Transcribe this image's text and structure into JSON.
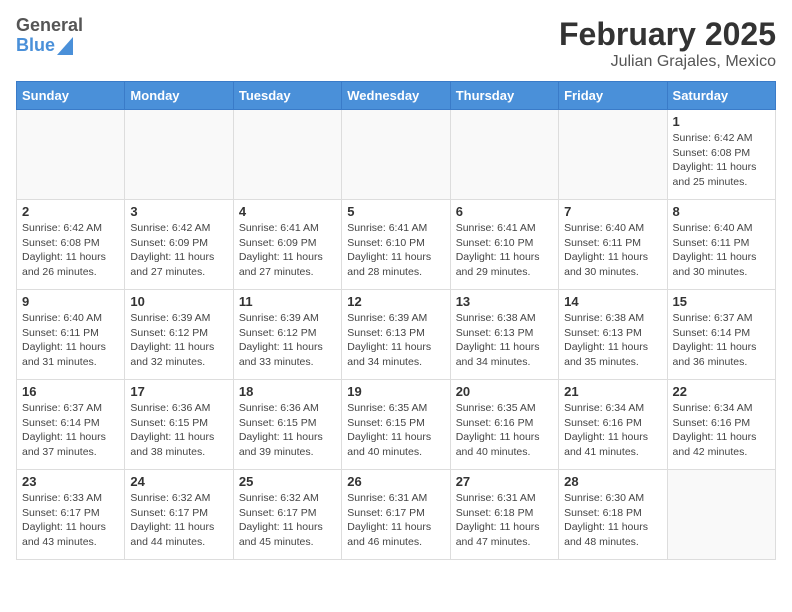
{
  "logo": {
    "text_general": "General",
    "text_blue": "Blue"
  },
  "header": {
    "month_year": "February 2025",
    "location": "Julian Grajales, Mexico"
  },
  "weekdays": [
    "Sunday",
    "Monday",
    "Tuesday",
    "Wednesday",
    "Thursday",
    "Friday",
    "Saturday"
  ],
  "weeks": [
    [
      {
        "day": "",
        "info": ""
      },
      {
        "day": "",
        "info": ""
      },
      {
        "day": "",
        "info": ""
      },
      {
        "day": "",
        "info": ""
      },
      {
        "day": "",
        "info": ""
      },
      {
        "day": "",
        "info": ""
      },
      {
        "day": "1",
        "info": "Sunrise: 6:42 AM\nSunset: 6:08 PM\nDaylight: 11 hours and 25 minutes."
      }
    ],
    [
      {
        "day": "2",
        "info": "Sunrise: 6:42 AM\nSunset: 6:08 PM\nDaylight: 11 hours and 26 minutes."
      },
      {
        "day": "3",
        "info": "Sunrise: 6:42 AM\nSunset: 6:09 PM\nDaylight: 11 hours and 27 minutes."
      },
      {
        "day": "4",
        "info": "Sunrise: 6:41 AM\nSunset: 6:09 PM\nDaylight: 11 hours and 27 minutes."
      },
      {
        "day": "5",
        "info": "Sunrise: 6:41 AM\nSunset: 6:10 PM\nDaylight: 11 hours and 28 minutes."
      },
      {
        "day": "6",
        "info": "Sunrise: 6:41 AM\nSunset: 6:10 PM\nDaylight: 11 hours and 29 minutes."
      },
      {
        "day": "7",
        "info": "Sunrise: 6:40 AM\nSunset: 6:11 PM\nDaylight: 11 hours and 30 minutes."
      },
      {
        "day": "8",
        "info": "Sunrise: 6:40 AM\nSunset: 6:11 PM\nDaylight: 11 hours and 30 minutes."
      }
    ],
    [
      {
        "day": "9",
        "info": "Sunrise: 6:40 AM\nSunset: 6:11 PM\nDaylight: 11 hours and 31 minutes."
      },
      {
        "day": "10",
        "info": "Sunrise: 6:39 AM\nSunset: 6:12 PM\nDaylight: 11 hours and 32 minutes."
      },
      {
        "day": "11",
        "info": "Sunrise: 6:39 AM\nSunset: 6:12 PM\nDaylight: 11 hours and 33 minutes."
      },
      {
        "day": "12",
        "info": "Sunrise: 6:39 AM\nSunset: 6:13 PM\nDaylight: 11 hours and 34 minutes."
      },
      {
        "day": "13",
        "info": "Sunrise: 6:38 AM\nSunset: 6:13 PM\nDaylight: 11 hours and 34 minutes."
      },
      {
        "day": "14",
        "info": "Sunrise: 6:38 AM\nSunset: 6:13 PM\nDaylight: 11 hours and 35 minutes."
      },
      {
        "day": "15",
        "info": "Sunrise: 6:37 AM\nSunset: 6:14 PM\nDaylight: 11 hours and 36 minutes."
      }
    ],
    [
      {
        "day": "16",
        "info": "Sunrise: 6:37 AM\nSunset: 6:14 PM\nDaylight: 11 hours and 37 minutes."
      },
      {
        "day": "17",
        "info": "Sunrise: 6:36 AM\nSunset: 6:15 PM\nDaylight: 11 hours and 38 minutes."
      },
      {
        "day": "18",
        "info": "Sunrise: 6:36 AM\nSunset: 6:15 PM\nDaylight: 11 hours and 39 minutes."
      },
      {
        "day": "19",
        "info": "Sunrise: 6:35 AM\nSunset: 6:15 PM\nDaylight: 11 hours and 40 minutes."
      },
      {
        "day": "20",
        "info": "Sunrise: 6:35 AM\nSunset: 6:16 PM\nDaylight: 11 hours and 40 minutes."
      },
      {
        "day": "21",
        "info": "Sunrise: 6:34 AM\nSunset: 6:16 PM\nDaylight: 11 hours and 41 minutes."
      },
      {
        "day": "22",
        "info": "Sunrise: 6:34 AM\nSunset: 6:16 PM\nDaylight: 11 hours and 42 minutes."
      }
    ],
    [
      {
        "day": "23",
        "info": "Sunrise: 6:33 AM\nSunset: 6:17 PM\nDaylight: 11 hours and 43 minutes."
      },
      {
        "day": "24",
        "info": "Sunrise: 6:32 AM\nSunset: 6:17 PM\nDaylight: 11 hours and 44 minutes."
      },
      {
        "day": "25",
        "info": "Sunrise: 6:32 AM\nSunset: 6:17 PM\nDaylight: 11 hours and 45 minutes."
      },
      {
        "day": "26",
        "info": "Sunrise: 6:31 AM\nSunset: 6:17 PM\nDaylight: 11 hours and 46 minutes."
      },
      {
        "day": "27",
        "info": "Sunrise: 6:31 AM\nSunset: 6:18 PM\nDaylight: 11 hours and 47 minutes."
      },
      {
        "day": "28",
        "info": "Sunrise: 6:30 AM\nSunset: 6:18 PM\nDaylight: 11 hours and 48 minutes."
      },
      {
        "day": "",
        "info": ""
      }
    ]
  ]
}
